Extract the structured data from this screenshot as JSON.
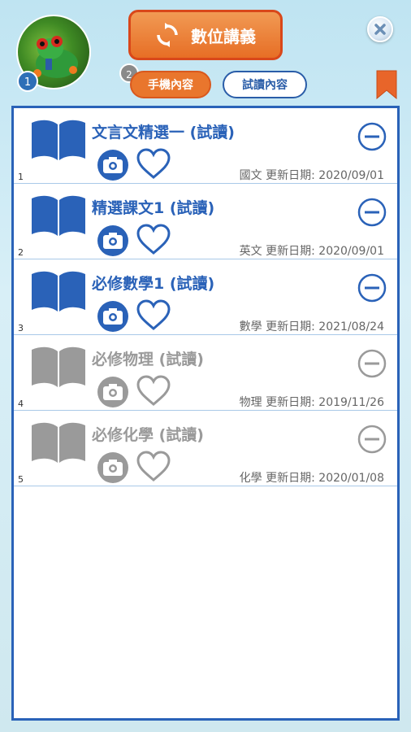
{
  "header": {
    "avatar_badge": "1",
    "main_button_label": "數位講義",
    "tab_badge": "2",
    "tabs": [
      {
        "label": "手機內容",
        "active": true
      },
      {
        "label": "試讀內容",
        "active": false
      }
    ],
    "icons": {
      "refresh": "refresh-icon",
      "close": "close-icon",
      "bookmark": "bookmark-icon"
    }
  },
  "colors": {
    "accent_blue": "#2a62b8",
    "orange": "#e9762d",
    "inactive_gray": "#9a9a9a"
  },
  "items": [
    {
      "index": "1",
      "title": "文言文精選一 (試讀)",
      "subject": "國文",
      "updated_label": "更新日期:",
      "date": "2020/09/01",
      "active": true
    },
    {
      "index": "2",
      "title": "精選課文1 (試讀)",
      "subject": "英文",
      "updated_label": "更新日期:",
      "date": "2020/09/01",
      "active": true
    },
    {
      "index": "3",
      "title": "必修數學1 (試讀)",
      "subject": "數學",
      "updated_label": "更新日期:",
      "date": "2021/08/24",
      "active": true
    },
    {
      "index": "4",
      "title": "必修物理 (試讀)",
      "subject": "物理",
      "updated_label": "更新日期:",
      "date": "2019/11/26",
      "active": false
    },
    {
      "index": "5",
      "title": "必修化學 (試讀)",
      "subject": "化學",
      "updated_label": "更新日期:",
      "date": "2020/01/08",
      "active": false
    }
  ]
}
